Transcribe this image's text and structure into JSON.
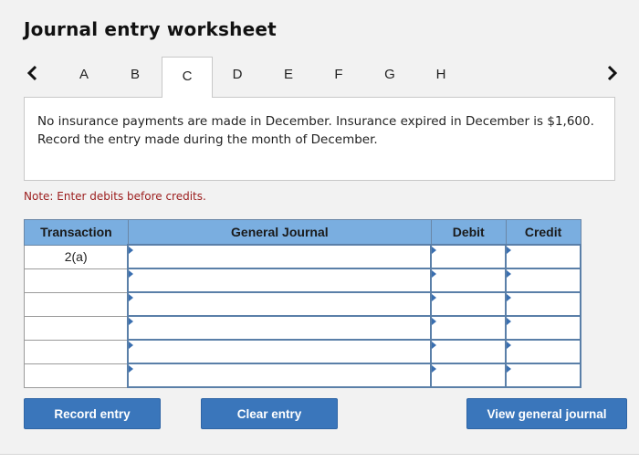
{
  "header": {
    "title": "Journal entry worksheet"
  },
  "tabs": {
    "prev_icon": "chevron-left-icon",
    "next_icon": "chevron-right-icon",
    "items": [
      {
        "label": "A",
        "active": false
      },
      {
        "label": "B",
        "active": false
      },
      {
        "label": "C",
        "active": true
      },
      {
        "label": "D",
        "active": false
      },
      {
        "label": "E",
        "active": false
      },
      {
        "label": "F",
        "active": false
      },
      {
        "label": "G",
        "active": false
      },
      {
        "label": "H",
        "active": false
      }
    ]
  },
  "prompt": {
    "text": "No insurance payments are made in December. Insurance expired in December is $1,600. Record the entry made during the month of December."
  },
  "note": "Note: Enter debits before credits.",
  "journal": {
    "headers": {
      "transaction": "Transaction",
      "general_journal": "General Journal",
      "debit": "Debit",
      "credit": "Credit"
    },
    "rows": [
      {
        "transaction": "2(a)",
        "account": "",
        "debit": "",
        "credit": ""
      },
      {
        "transaction": "",
        "account": "",
        "debit": "",
        "credit": ""
      },
      {
        "transaction": "",
        "account": "",
        "debit": "",
        "credit": ""
      },
      {
        "transaction": "",
        "account": "",
        "debit": "",
        "credit": ""
      },
      {
        "transaction": "",
        "account": "",
        "debit": "",
        "credit": ""
      },
      {
        "transaction": "",
        "account": "",
        "debit": "",
        "credit": ""
      }
    ]
  },
  "buttons": {
    "record": "Record entry",
    "clear": "Clear entry",
    "view": "View general journal"
  },
  "colors": {
    "button_bg": "#3a76bb",
    "header_bg": "#7aaee0",
    "note_text": "#9b1c1c",
    "cell_border": "#5a7fa8"
  }
}
